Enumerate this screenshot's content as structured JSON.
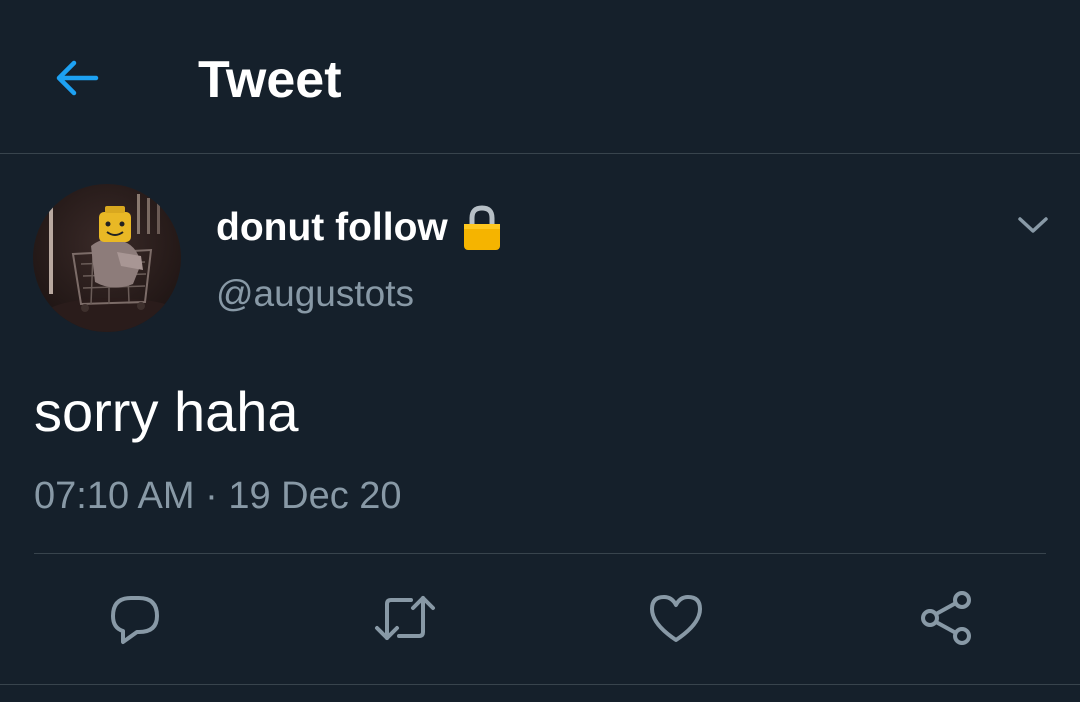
{
  "header": {
    "title": "Tweet",
    "back_icon": "arrow-left-icon"
  },
  "tweet": {
    "author": {
      "display_name": "donut follow",
      "handle": "@augustots",
      "protected_icon": "lock-icon",
      "avatar_icon": "avatar-photo"
    },
    "text": "sorry haha",
    "time": "07:10 AM",
    "separator": "·",
    "date": "19 Dec 20",
    "menu_icon": "chevron-down-icon"
  },
  "actions": [
    {
      "name": "reply",
      "icon": "comment-icon"
    },
    {
      "name": "retweet",
      "icon": "retweet-icon"
    },
    {
      "name": "like",
      "icon": "heart-icon"
    },
    {
      "name": "share",
      "icon": "share-icon"
    }
  ],
  "colors": {
    "background": "#15202b",
    "accent": "#1da1f2",
    "secondary_text": "#8899a6",
    "divider": "#38444d",
    "icon": "#8899a6"
  }
}
